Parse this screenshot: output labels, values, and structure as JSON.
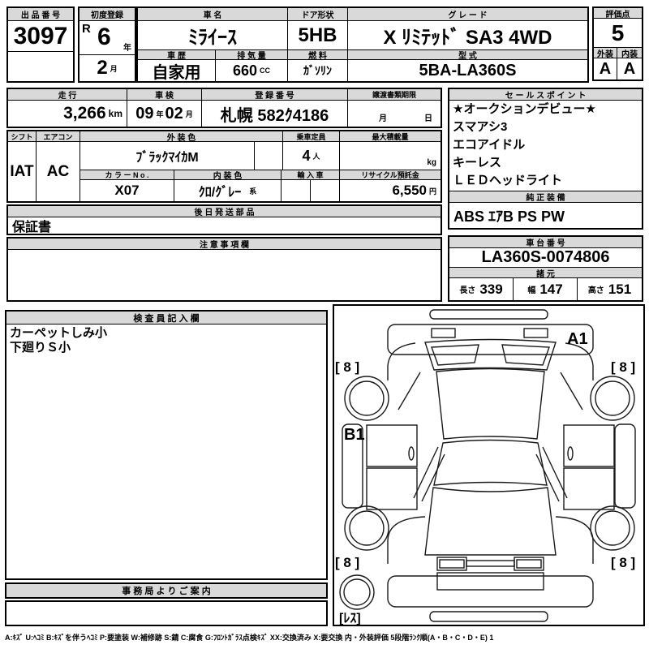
{
  "colors": {
    "header_bg": "#d9d9d9",
    "line": "#000000",
    "paper": "#ffffff"
  },
  "lot": {
    "label": "出 品 番 号",
    "value": "3097"
  },
  "first_reg": {
    "label": "初度登録",
    "era": "R",
    "year": "6",
    "year_unit": "年",
    "month": "2",
    "month_unit": "月"
  },
  "car_name": {
    "label": "車 名",
    "value": "ﾐﾗｲｰｽ"
  },
  "door": {
    "label": "ドア形状",
    "value": "5HB"
  },
  "grade": {
    "label": "グ レ ー ド",
    "value": "X ﾘﾐﾃｯﾄﾞ SA3 4WD"
  },
  "score": {
    "label": "評価点",
    "value": "5",
    "ext_label": "外装",
    "ext": "A",
    "int_label": "内装",
    "int": "A"
  },
  "history": {
    "label": "車 歴",
    "value": "自家用"
  },
  "displacement": {
    "label": "排 気 量",
    "value": "660",
    "unit": "CC"
  },
  "fuel": {
    "label": "燃 料",
    "value": "ｶﾞｿﾘﾝ"
  },
  "model": {
    "label": "型 式",
    "value": "5BA-LA360S"
  },
  "mileage": {
    "label": "走 行",
    "value": "3,266",
    "unit": "km"
  },
  "inspection": {
    "label": "車 検",
    "year": "09",
    "year_unit": "年",
    "month": "02",
    "month_unit": "月"
  },
  "reg_no": {
    "label": "登 録 番 号",
    "value": "札幌 582ｸ4186"
  },
  "transfer": {
    "label": "譲渡書類期限",
    "month_unit": "月",
    "day_unit": "日"
  },
  "shift": {
    "label": "シフト",
    "value": "IAT"
  },
  "aircon": {
    "label": "エアコン",
    "value": "AC"
  },
  "body_color": {
    "label": "外 装 色",
    "value": "ﾌﾞﾗｯｸﾏｲｶM"
  },
  "capacity": {
    "label": "乗車定員",
    "value": "4",
    "unit": "人"
  },
  "max_load": {
    "label": "最大積載量",
    "unit": "kg"
  },
  "color_no": {
    "label": "カ ラ ー N o .",
    "value": "X07"
  },
  "int_color": {
    "label": "内 装 色",
    "value": "ｸﾛ/ｸﾞﾚｰ",
    "suffix": "系"
  },
  "import_car": {
    "label": "輸 入 車"
  },
  "recycle": {
    "label": "リサイクル預託金",
    "value": "6,550",
    "unit": "円"
  },
  "later_parts": {
    "label": "後 日 発 送 部 品",
    "value": "保証書"
  },
  "caution": {
    "label": "注 意 事 項 欄"
  },
  "sales_points": {
    "label": "セ ー ル ス ポ イ ン ト",
    "items": [
      "★オークションデビュー★",
      "スマアシ3",
      "エコアイドル",
      "キーレス",
      "ＬＥＤヘッドライト"
    ]
  },
  "oem": {
    "label": "純 正 装 備",
    "value": "ABS ｴｱB PS PW"
  },
  "chassis": {
    "label": "車 台 番 号",
    "value": "LA360S-0074806"
  },
  "specs": {
    "label": "諸 元",
    "length_label": "長さ",
    "length": "339",
    "width_label": "幅",
    "width": "147",
    "height_label": "高さ",
    "height": "151"
  },
  "inspector": {
    "label": "検 査 員 記 入 欄",
    "notes": [
      "カーペットしみ小",
      "下廻りＳ小"
    ]
  },
  "office": {
    "label": "事 務 局 よ り ご 案 内"
  },
  "diagram": {
    "mark_a1": "A1",
    "mark_b1": "B1",
    "corner_mark": "[ 8 ]",
    "spare_mark": "[ﾚｽ]"
  },
  "legend": "A:ｷｽﾞ U:ﾍｺﾐ B:ｷｽﾞを伴うﾍｺﾐ P:要塗装 W:補修跡 S:錆 C:腐食 G:ﾌﾛﾝﾄｶﾞﾗｽ点検ｷｽﾞ XX:交換済み X:要交換  内・外装評価  5段階ﾗﾝｸ順(A・B・C・D・E) 1"
}
